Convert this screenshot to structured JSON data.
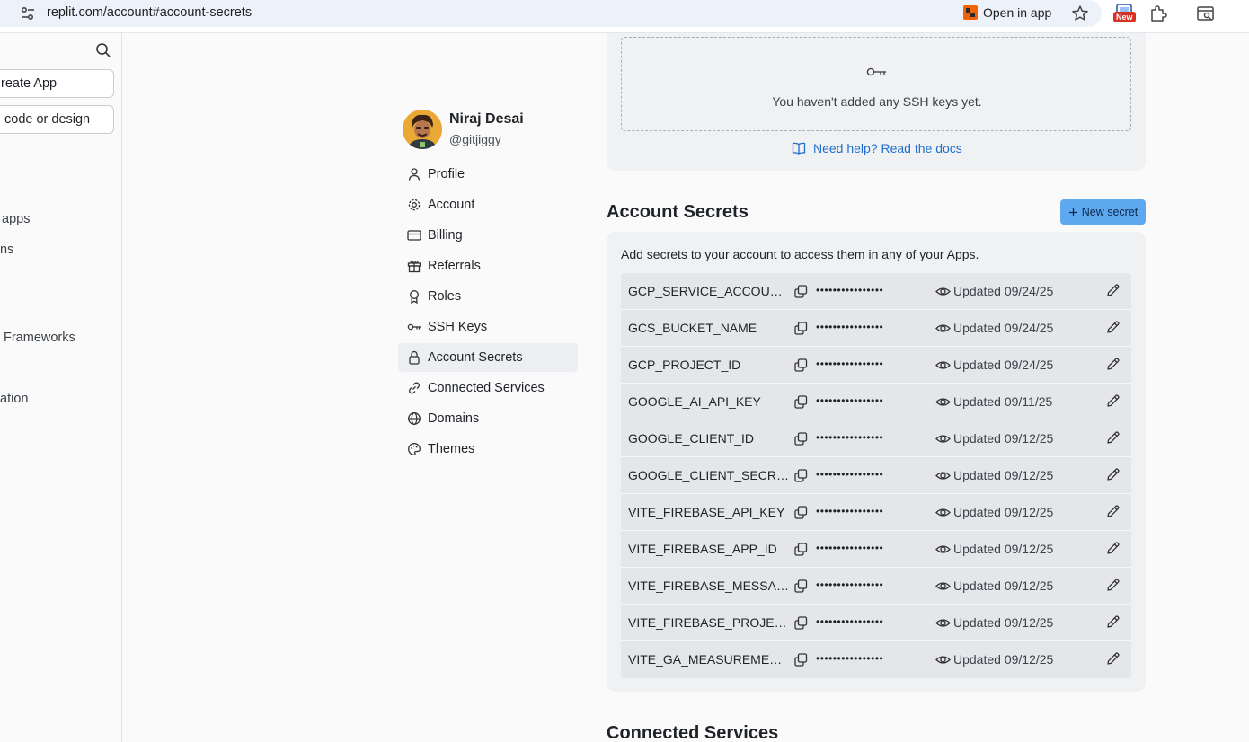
{
  "browser": {
    "url": "replit.com/account#account-secrets",
    "open_in_app": "Open in app",
    "new_badge": "New"
  },
  "left_sidebar": {
    "create_app": "reate App",
    "import": "code or design",
    "items": [
      "apps",
      "ns",
      "Frameworks",
      "ation"
    ]
  },
  "profile": {
    "name": "Niraj Desai",
    "handle": "@gitjiggy"
  },
  "nav": [
    {
      "label": "Profile",
      "icon": "user-icon"
    },
    {
      "label": "Account",
      "icon": "gear-icon"
    },
    {
      "label": "Billing",
      "icon": "credit-card-icon"
    },
    {
      "label": "Referrals",
      "icon": "gift-icon"
    },
    {
      "label": "Roles",
      "icon": "badge-icon"
    },
    {
      "label": "SSH Keys",
      "icon": "key-icon"
    },
    {
      "label": "Account Secrets",
      "icon": "lock-icon",
      "active": true
    },
    {
      "label": "Connected Services",
      "icon": "link-icon"
    },
    {
      "label": "Domains",
      "icon": "globe-icon"
    },
    {
      "label": "Themes",
      "icon": "palette-icon"
    }
  ],
  "ssh": {
    "empty_text": "You haven't added any SSH keys yet.",
    "help_link": "Need help? Read the docs"
  },
  "secrets": {
    "title": "Account Secrets",
    "new_button": "New secret",
    "description": "Add secrets to your account to access them in any of your Apps.",
    "mask": "••••••••••••••••",
    "rows": [
      {
        "name": "GCP_SERVICE_ACCOUNT_…",
        "updated": "Updated 09/24/25"
      },
      {
        "name": "GCS_BUCKET_NAME",
        "updated": "Updated 09/24/25"
      },
      {
        "name": "GCP_PROJECT_ID",
        "updated": "Updated 09/24/25"
      },
      {
        "name": "GOOGLE_AI_API_KEY",
        "updated": "Updated 09/11/25"
      },
      {
        "name": "GOOGLE_CLIENT_ID",
        "updated": "Updated 09/12/25"
      },
      {
        "name": "GOOGLE_CLIENT_SECRET",
        "updated": "Updated 09/12/25"
      },
      {
        "name": "VITE_FIREBASE_API_KEY",
        "updated": "Updated 09/12/25"
      },
      {
        "name": "VITE_FIREBASE_APP_ID",
        "updated": "Updated 09/12/25"
      },
      {
        "name": "VITE_FIREBASE_MESSAG…",
        "updated": "Updated 09/12/25"
      },
      {
        "name": "VITE_FIREBASE_PROJECT…",
        "updated": "Updated 09/12/25"
      },
      {
        "name": "VITE_GA_MEASUREMENT…",
        "updated": "Updated 09/12/25"
      }
    ]
  },
  "connected_services": {
    "title": "Connected Services"
  }
}
